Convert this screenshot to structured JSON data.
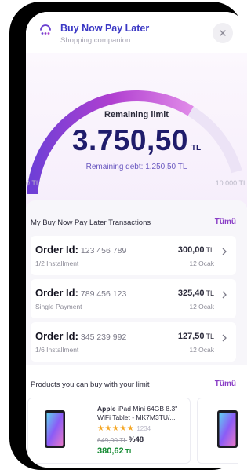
{
  "header": {
    "title": "Buy Now Pay Later",
    "subtitle": "Shopping companion",
    "close_icon": "close-icon",
    "logo_icon": "bnpl-logo-icon"
  },
  "limit": {
    "label": "Remaining limit",
    "amount": "3.750,50",
    "currency": "TL",
    "debt": "Remaining debt: 1.250,50 TL",
    "min_label": "0 TL",
    "max_label": "10.000 TL",
    "used_fraction": 0.375,
    "gauge_colors": [
      "#6f3fd6",
      "#b03fd0",
      "#e08ae8"
    ]
  },
  "transactions": {
    "title": "My Buy Now Pay Later Transactions",
    "see_all": "Tümü",
    "items": [
      {
        "order_label": "Order Id:",
        "id": "123 456 789",
        "sub": "1/2 Installment",
        "amount": "300,00",
        "currency": "TL",
        "date": "12 Ocak"
      },
      {
        "order_label": "Order Id:",
        "id": "789 456 123",
        "sub": "Single Payment",
        "amount": "325,40",
        "currency": "TL",
        "date": "12 Ocak"
      },
      {
        "order_label": "Order Id:",
        "id": "345 239 992",
        "sub": "1/6 Installment",
        "amount": "127,50",
        "currency": "TL",
        "date": "12 Ocak"
      }
    ]
  },
  "products": {
    "title": "Products you can buy with your limit",
    "see_all": "Tümü",
    "items": [
      {
        "brand": "Apple",
        "name": "iPad Mini 64GB 8.3\" WiFi Tablet - MK7M3TU/...",
        "stars": "★★★★★",
        "rating": 4.5,
        "rating_count": "1234",
        "old_price": "649,00 TL",
        "discount": "%48",
        "price": "380,62",
        "currency": "TL"
      }
    ]
  },
  "colors": {
    "accent": "#3a37c4",
    "amount": "#1f1c6b",
    "link": "#8a3ec6",
    "price_green": "#148a32",
    "star": "#f5a623"
  }
}
